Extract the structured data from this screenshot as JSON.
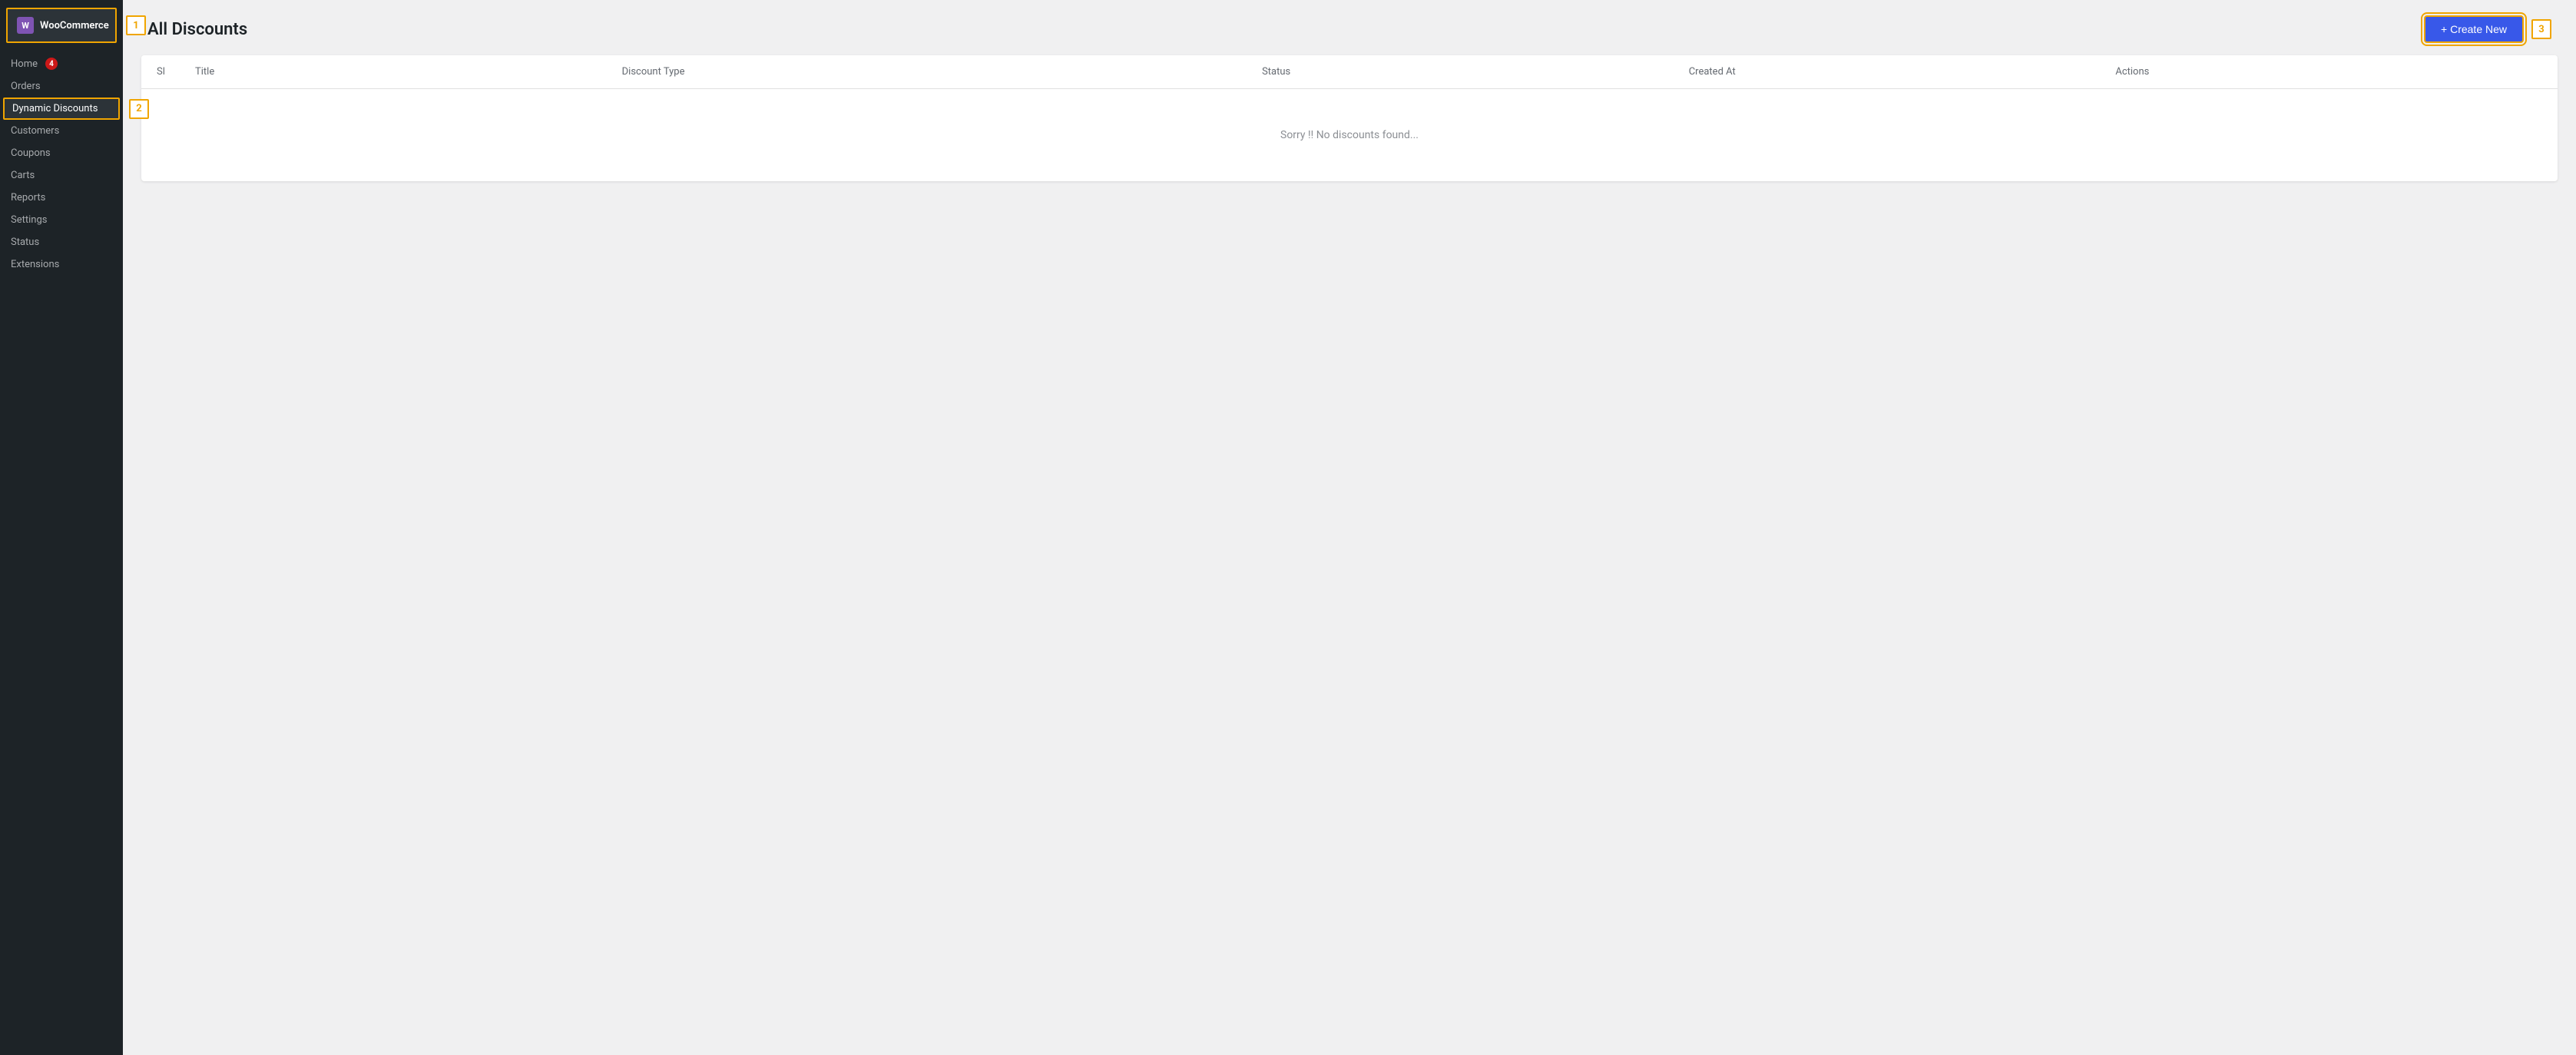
{
  "sidebar": {
    "brand_label": "WooCommerce",
    "woo_icon": "W",
    "nav_items": [
      {
        "id": "home",
        "label": "Home",
        "badge": 4,
        "active": false
      },
      {
        "id": "orders",
        "label": "Orders",
        "badge": null,
        "active": false
      },
      {
        "id": "dynamic-discounts",
        "label": "Dynamic Discounts",
        "badge": null,
        "active": true
      },
      {
        "id": "customers",
        "label": "Customers",
        "badge": null,
        "active": false
      },
      {
        "id": "coupons",
        "label": "Coupons",
        "badge": null,
        "active": false
      },
      {
        "id": "carts",
        "label": "Carts",
        "badge": null,
        "active": false
      },
      {
        "id": "reports",
        "label": "Reports",
        "badge": null,
        "active": false
      },
      {
        "id": "settings",
        "label": "Settings",
        "badge": null,
        "active": false
      },
      {
        "id": "status",
        "label": "Status",
        "badge": null,
        "active": false
      },
      {
        "id": "extensions",
        "label": "Extensions",
        "badge": null,
        "active": false
      }
    ]
  },
  "annotations": {
    "a1": "1",
    "a2": "2",
    "a3": "3"
  },
  "header": {
    "title": "All Discounts",
    "create_button": "+ Create New"
  },
  "table": {
    "columns": [
      "Sl",
      "Title",
      "Discount Type",
      "Status",
      "Created At",
      "Actions"
    ],
    "empty_message": "Sorry !! No discounts found..."
  }
}
